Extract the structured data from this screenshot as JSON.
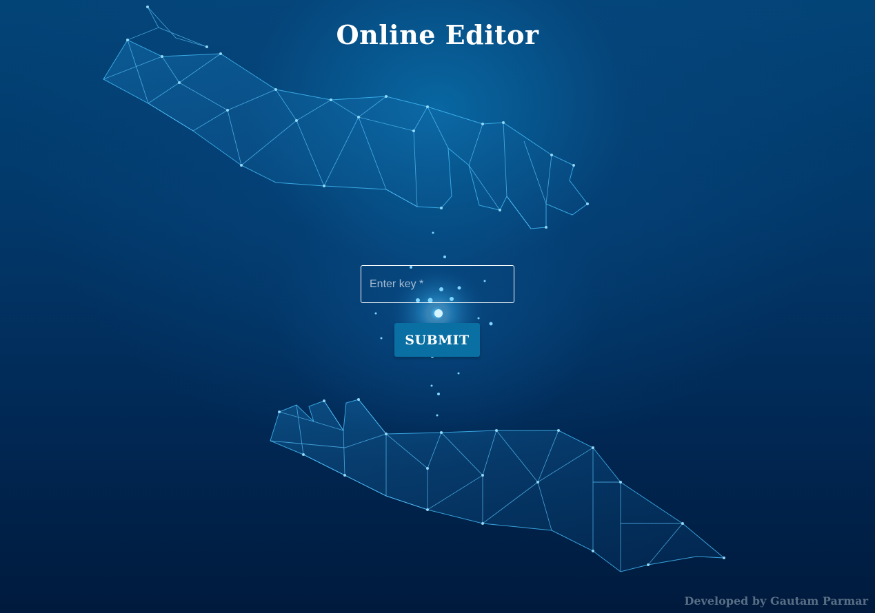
{
  "header": {
    "title": "Online Editor"
  },
  "form": {
    "key_placeholder": "Enter key *",
    "key_value": "",
    "submit_label": "SUBMIT"
  },
  "footer": {
    "credit": "Developed by Gautam Parmar"
  },
  "theme": {
    "background_dark": "#001a3d",
    "background_mid": "#034477",
    "mesh_color": "#3ab8f5",
    "button_color": "#0a6fa3",
    "footer_text_color": "#586e85"
  },
  "background": {
    "illustration": "polygonal-hands-mesh"
  }
}
